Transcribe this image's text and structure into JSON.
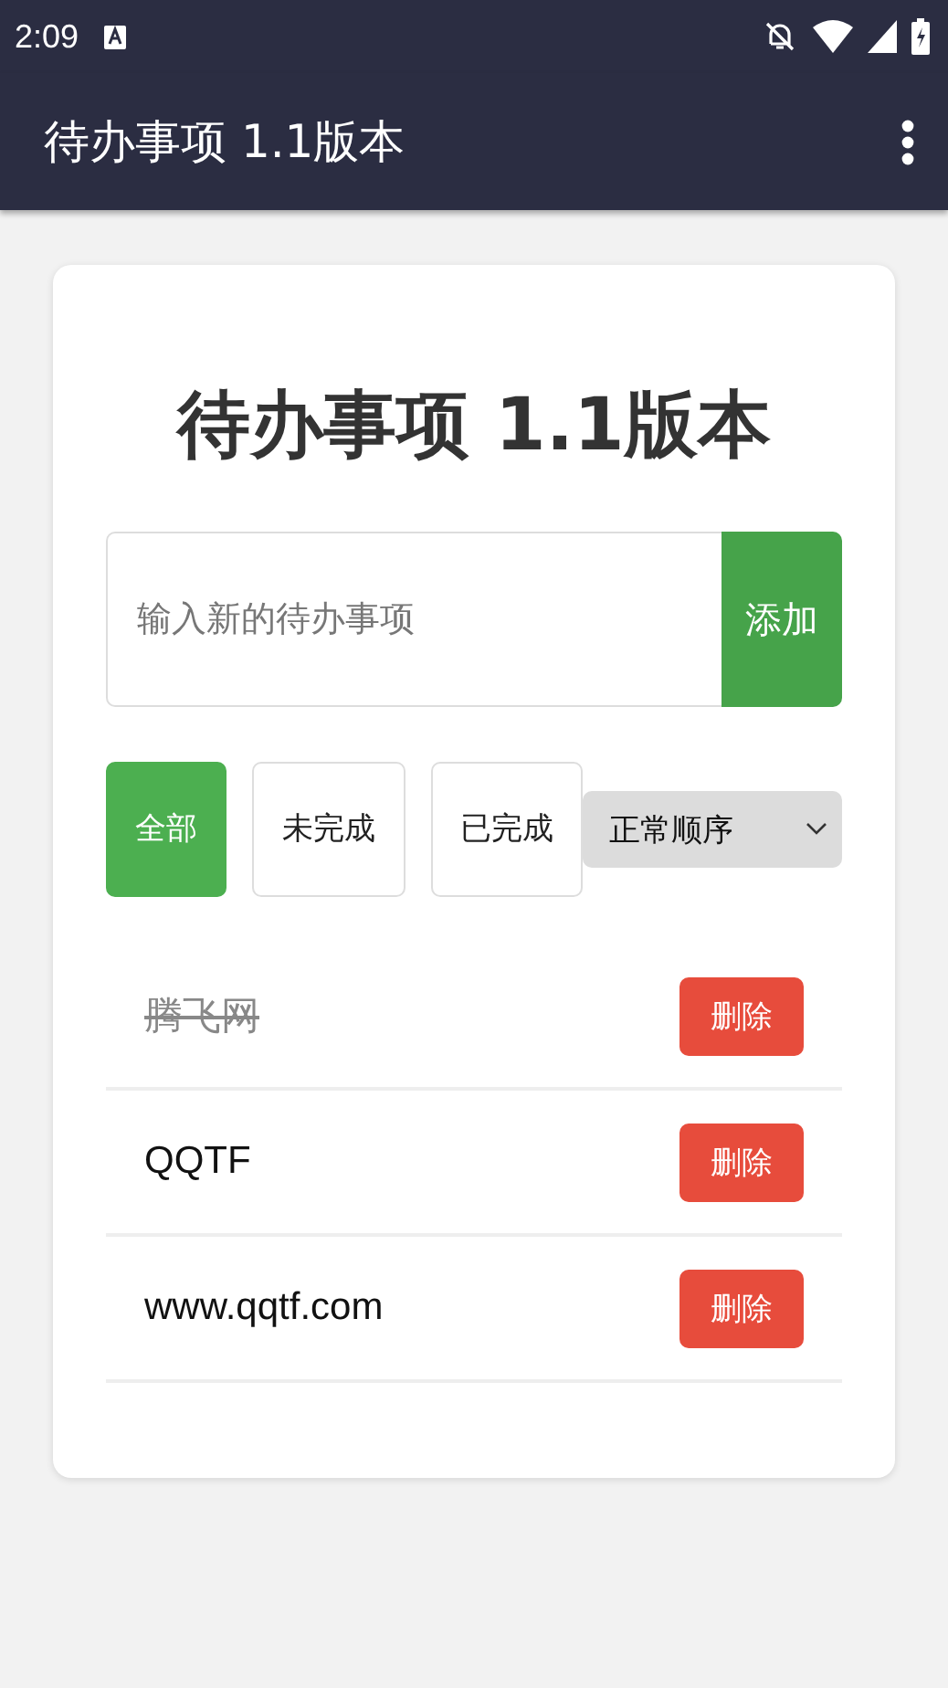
{
  "status_bar": {
    "time": "2:09"
  },
  "app_bar": {
    "title": "待办事项 1.1版本"
  },
  "card": {
    "heading": "待办事项 1.1版本",
    "input": {
      "placeholder": "输入新的待办事项"
    },
    "add_button": "添加",
    "filters": [
      {
        "label": "全部",
        "selected": true
      },
      {
        "label": "未完成",
        "selected": false
      },
      {
        "label": "已完成",
        "selected": false
      }
    ],
    "sort_select": {
      "value": "正常顺序"
    },
    "todos": [
      {
        "text": "腾飞网",
        "completed": true,
        "delete_label": "删除"
      },
      {
        "text": "QQTF",
        "completed": false,
        "delete_label": "删除"
      },
      {
        "text": "www.qqtf.com",
        "completed": false,
        "delete_label": "删除"
      }
    ]
  }
}
